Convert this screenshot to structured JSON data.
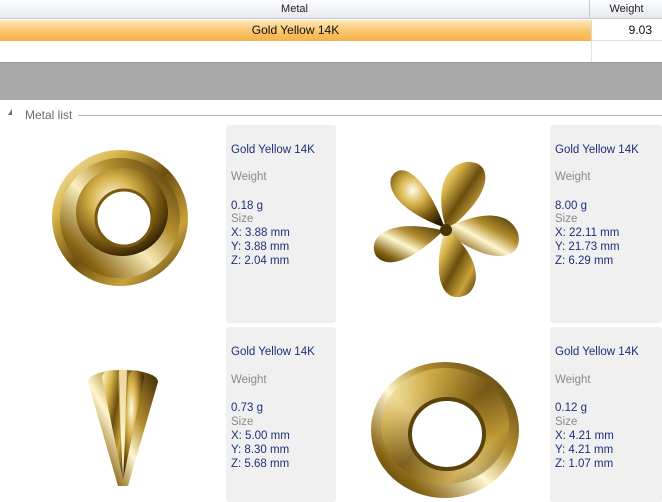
{
  "grid": {
    "columns": {
      "metal": "Metal",
      "weight": "Weight"
    },
    "rows": [
      {
        "metal": "Gold Yellow 14K",
        "weight": "9.03"
      }
    ]
  },
  "group": {
    "title": "Metal list"
  },
  "labels": {
    "weight": "Weight",
    "size": "Size"
  },
  "items": [
    {
      "metal": "Gold Yellow 14K",
      "weight": "0.18 g",
      "x": "X: 3.88 mm",
      "y": "Y: 3.88 mm",
      "z": "Z: 2.04 mm",
      "icon": "bead-ring-icon"
    },
    {
      "metal": "Gold Yellow 14K",
      "weight": "8.00 g",
      "x": "X: 22.11 mm",
      "y": "Y: 21.73 mm",
      "z": "Z: 6.29 mm",
      "icon": "flower-icon"
    },
    {
      "metal": "Gold Yellow 14K",
      "weight": "0.73 g",
      "x": "X: 5.00 mm",
      "y": "Y: 8.30 mm",
      "z": "Z: 5.68 mm",
      "icon": "bail-cap-icon"
    },
    {
      "metal": "Gold Yellow 14K",
      "weight": "0.12 g",
      "x": "X: 4.21 mm",
      "y": "Y: 4.21 mm",
      "z": "Z: 1.07 mm",
      "icon": "jump-ring-icon"
    }
  ]
}
